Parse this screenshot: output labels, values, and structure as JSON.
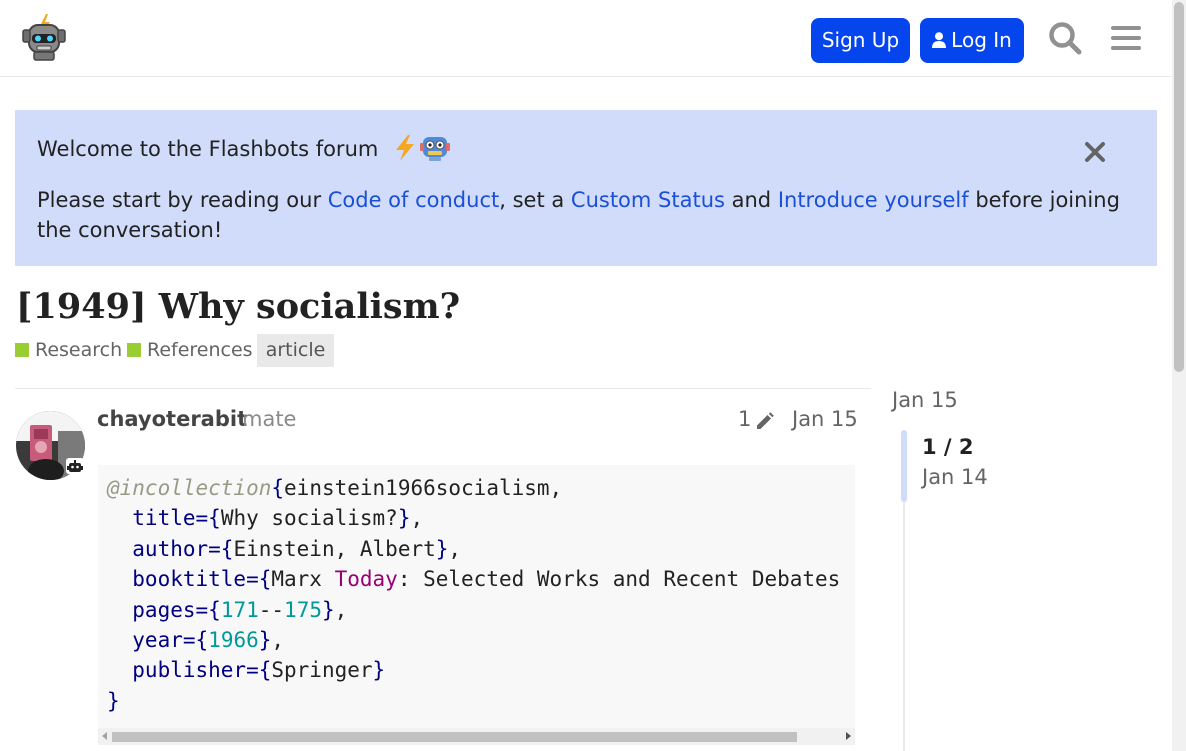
{
  "header": {
    "signup_label": "Sign Up",
    "login_label": "Log In",
    "brand_color": "#0545ed"
  },
  "banner": {
    "title": "Welcome to the Flashbots forum",
    "title_emoji": [
      "lightning-icon",
      "robot-icon"
    ],
    "intro": "Please start by reading our ",
    "link1": "Code of conduct",
    "sep1": ", set a ",
    "link2": "Custom Status",
    "sep2": " and ",
    "link3": "Introduce yourself",
    "outro": " before joining the conversation!",
    "bg_color": "#d1dcfb"
  },
  "topic": {
    "title": "[1949] Why socialism?",
    "categories": [
      "Research",
      "References"
    ],
    "category_color": "#9acd32",
    "tag": "article"
  },
  "post": {
    "username": "chayoterabit",
    "user_title": "mate",
    "edit_count": "1",
    "date": "Jan 15",
    "code": {
      "l1_at": "@incollection",
      "l1_rest": "einstein1966socialism,",
      "l2_key": "  title=",
      "l2_val": "Why socialism?",
      "l3_key": "  author=",
      "l3_val": "Einstein, Albert",
      "l4_key": "  booktitle=",
      "l4_a": "Marx ",
      "l4_kw": "Today",
      "l4_b": ": Selected Works and Recent Debates",
      "l5_key": "  pages=",
      "l5_n1": "171",
      "l5_dash": "--",
      "l5_n2": "175",
      "l6_key": "  year=",
      "l6_val": "1966",
      "l7_key": "  publisher=",
      "l7_val": "Springer"
    }
  },
  "timeline": {
    "start_date": "Jan 15",
    "position": "1 / 2",
    "current_date": "Jan 14"
  }
}
